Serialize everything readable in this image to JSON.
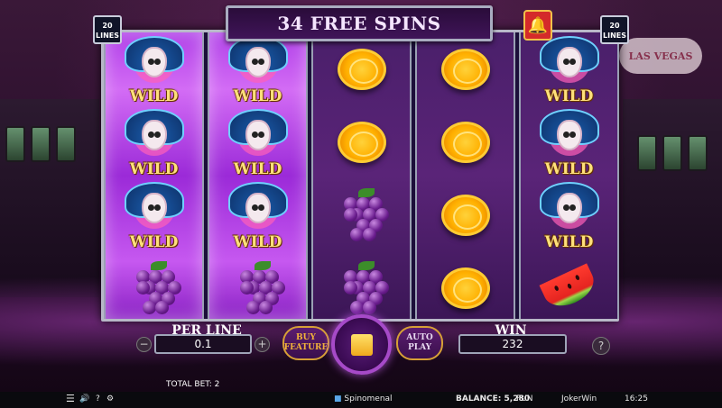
{
  "banner": {
    "free_spins": "34 FREE SPINS"
  },
  "lines_badge": {
    "count": "20",
    "label": "LINES"
  },
  "bell_icon": "bell-icon",
  "vegas_sign": "LAS VEGAS",
  "reels": [
    {
      "wild_reel": true,
      "symbols": [
        "wild",
        "wild",
        "wild",
        "grapes"
      ]
    },
    {
      "wild_reel": true,
      "symbols": [
        "wild",
        "wild",
        "wild",
        "grapes"
      ]
    },
    {
      "wild_reel": false,
      "symbols": [
        "orange",
        "orange",
        "grapes",
        "grapes"
      ]
    },
    {
      "wild_reel": false,
      "symbols": [
        "orange",
        "orange",
        "orange",
        "orange"
      ]
    },
    {
      "wild_reel": false,
      "symbols": [
        "wild",
        "wild",
        "wild",
        "watermelon"
      ]
    }
  ],
  "wild_label": "WILD",
  "controls": {
    "per_line_label": "PER LINE",
    "per_line_value": "0.1",
    "minus": "−",
    "plus": "+",
    "buy_feature": "BUY FEATURE",
    "auto_play": "AUTO PLAY",
    "win_label": "WIN",
    "win_value": "232",
    "help": "?"
  },
  "total_bet": "TOTAL BET: 2",
  "status_bar": {
    "menu": "☰",
    "sound": "🔊",
    "help": "?",
    "settings": "⚙",
    "brand": "Spinomenal",
    "balance": "BALANCE: 5,280",
    "mode": "FUN",
    "site": "JokerWin",
    "time": "16:25"
  },
  "colors": {
    "wild_reel": "#c050ec",
    "reel": "#4e1f70",
    "accent_gold": "#f0b830"
  }
}
